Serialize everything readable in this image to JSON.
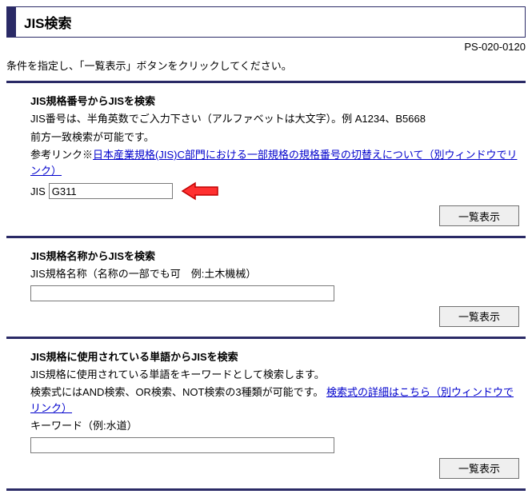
{
  "header": {
    "title": "JIS検索",
    "page_code": "PS-020-0120"
  },
  "instruction": "条件を指定し、「一覧表示」ボタンをクリックしてください。",
  "section1": {
    "title": "JIS規格番号からJISを検索",
    "line1": "JIS番号は、半角英数でご入力下さい（アルファベットは大文字）。例 A1234、B5668",
    "line2": "前方一致検索が可能です。",
    "ref_prefix": "参考リンク※",
    "ref_link": "日本産業規格(JIS)C部門における一部規格の規格番号の切替えについて（別ウィンドウでリンク）",
    "input_label": "JIS",
    "input_value": "G311",
    "button": "一覧表示"
  },
  "section2": {
    "title": "JIS規格名称からJISを検索",
    "line1": "JIS規格名称（名称の一部でも可　例:土木機械）",
    "input_value": "",
    "button": "一覧表示"
  },
  "section3": {
    "title": "JIS規格に使用されている単語からJISを検索",
    "line1": "JIS規格に使用されている単語をキーワードとして検索します。",
    "line2_prefix": "検索式にはAND検索、OR検索、NOT検索の3種類が可能です。",
    "line2_link": "検索式の詳細はこちら（別ウィンドウでリンク）",
    "keyword_label": "キーワード（例:水道）",
    "input_value": "",
    "button": "一覧表示"
  }
}
